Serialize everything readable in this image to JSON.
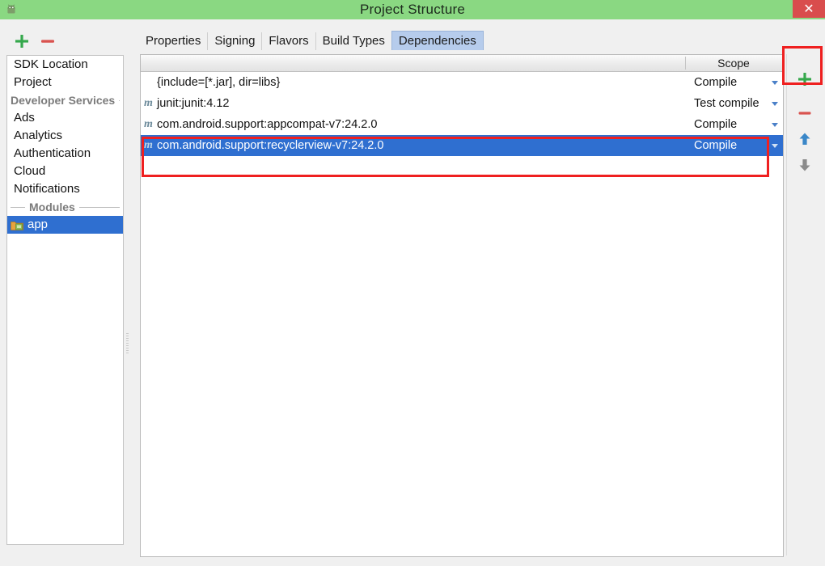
{
  "window": {
    "title": "Project Structure",
    "app_icon": "android-robot-icon",
    "close_label": "✕",
    "title_bar_color": "#8ad882",
    "close_button_color": "#d94d4d"
  },
  "left_toolbar": {
    "add_label": "+",
    "remove_label": "−",
    "add_color": "#35a84c",
    "remove_color": "#d9534f"
  },
  "sidebar": {
    "items": [
      {
        "label": "SDK Location",
        "type": "item",
        "selected": false
      },
      {
        "label": "Project",
        "type": "item",
        "selected": false
      },
      {
        "label": "Developer Services",
        "type": "section"
      },
      {
        "label": "Ads",
        "type": "item",
        "selected": false
      },
      {
        "label": "Analytics",
        "type": "item",
        "selected": false
      },
      {
        "label": "Authentication",
        "type": "item",
        "selected": false
      },
      {
        "label": "Cloud",
        "type": "item",
        "selected": false
      },
      {
        "label": "Notifications",
        "type": "item",
        "selected": false
      },
      {
        "label": "Modules",
        "type": "section"
      },
      {
        "label": "app",
        "type": "module",
        "selected": true
      }
    ]
  },
  "tabs": [
    {
      "label": "Properties",
      "active": false
    },
    {
      "label": "Signing",
      "active": false
    },
    {
      "label": "Flavors",
      "active": false
    },
    {
      "label": "Build Types",
      "active": false
    },
    {
      "label": "Dependencies",
      "active": true
    }
  ],
  "table": {
    "columns": [
      {
        "label": ""
      },
      {
        "label": "Scope"
      }
    ],
    "rows": [
      {
        "icon": "",
        "name": "{include=[*.jar], dir=libs}",
        "scope": "Compile",
        "selected": false
      },
      {
        "icon": "m",
        "name": "junit:junit:4.12",
        "scope": "Test compile",
        "selected": false
      },
      {
        "icon": "m",
        "name": "com.android.support:appcompat-v7:24.2.0",
        "scope": "Compile",
        "selected": false
      },
      {
        "icon": "m",
        "name": "com.android.support:recyclerview-v7:24.2.0",
        "scope": "Compile",
        "selected": true
      }
    ]
  },
  "right_toolbar": {
    "buttons": [
      {
        "name": "add",
        "label": "+",
        "color": "#35a84c"
      },
      {
        "name": "remove",
        "label": "−",
        "color": "#d9534f"
      },
      {
        "name": "move-up",
        "label": "↑",
        "color": "#3a87c8"
      },
      {
        "name": "move-down",
        "label": "↓",
        "color": "#8b8b8b"
      }
    ]
  },
  "annotations": {
    "highlight_color": "#ef2020",
    "boxes": [
      {
        "name": "add-dependency-button-highlight"
      },
      {
        "name": "selected-dependency-row-highlight"
      }
    ]
  }
}
